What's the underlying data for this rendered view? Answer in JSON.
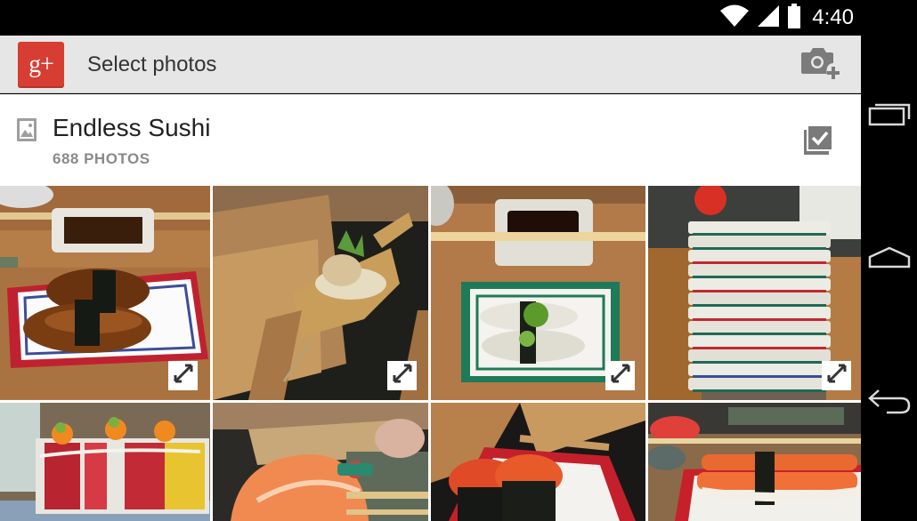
{
  "status_bar": {
    "time": "4:40",
    "icons": [
      "wifi-icon",
      "signal-icon",
      "battery-icon"
    ]
  },
  "action_bar": {
    "logo_text": "g+",
    "title": "Select photos",
    "add_photo_icon": "camera-add-icon"
  },
  "album": {
    "title": "Endless Sushi",
    "count": "688 PHOTOS",
    "icon": "album-image-icon",
    "select_all_icon": "select-all-checkbox-icon"
  },
  "grid": {
    "photos": [
      {
        "subject": "eel nigiri on red plate"
      },
      {
        "subject": "sushi boat on conveyor"
      },
      {
        "subject": "fish nigiri on green plate"
      },
      {
        "subject": "stack of plates"
      },
      {
        "subject": "tuna rolls with roe"
      },
      {
        "subject": "salmon nigiri"
      },
      {
        "subject": "salmon roe gunkan"
      },
      {
        "subject": "crab stick nigiri"
      }
    ],
    "expand_icon": "expand-icon"
  },
  "navigation": {
    "items": [
      "recent-apps-icon",
      "home-icon",
      "back-icon"
    ]
  },
  "colors": {
    "brand": "#d73d32",
    "action_bar": "#e6e6e6",
    "status_bar": "#000000"
  }
}
